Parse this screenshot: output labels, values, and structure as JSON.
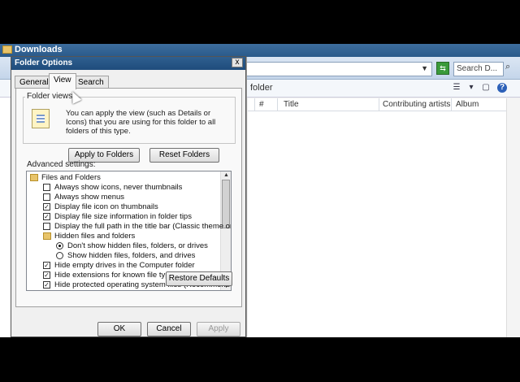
{
  "explorer": {
    "title": "Downloads",
    "search_placeholder": "Search D...",
    "breadcrumb": "folder",
    "columns": [
      "#",
      "Title",
      "Contributing artists",
      "Album"
    ],
    "go_icon": "refresh-icon",
    "help_icon": "help-icon"
  },
  "dialog": {
    "title": "Folder Options",
    "close_label": "x",
    "tabs": [
      "General",
      "View",
      "Search"
    ],
    "active_tab": "View",
    "folder_views": {
      "label": "Folder views",
      "description": "You can apply the view (such as Details or Icons) that you are using for this folder to all folders of this type.",
      "apply_button": "Apply to Folders",
      "reset_button": "Reset Folders"
    },
    "advanced_label": "Advanced settings:",
    "settings": [
      {
        "type": "folder",
        "label": "Files and Folders",
        "indent": 0
      },
      {
        "type": "checkbox",
        "label": "Always show icons, never thumbnails",
        "checked": false,
        "indent": 1
      },
      {
        "type": "checkbox",
        "label": "Always show menus",
        "checked": false,
        "indent": 1
      },
      {
        "type": "checkbox",
        "label": "Display file icon on thumbnails",
        "checked": true,
        "indent": 1
      },
      {
        "type": "checkbox",
        "label": "Display file size information in folder tips",
        "checked": true,
        "indent": 1
      },
      {
        "type": "checkbox",
        "label": "Display the full path in the title bar (Classic theme only)",
        "checked": false,
        "indent": 1
      },
      {
        "type": "folder",
        "label": "Hidden files and folders",
        "indent": 1
      },
      {
        "type": "radio",
        "label": "Don't show hidden files, folders, or drives",
        "checked": true,
        "indent": 2
      },
      {
        "type": "radio",
        "label": "Show hidden files, folders, and drives",
        "checked": false,
        "indent": 2
      },
      {
        "type": "checkbox",
        "label": "Hide empty drives in the Computer folder",
        "checked": true,
        "indent": 1
      },
      {
        "type": "checkbox",
        "label": "Hide extensions for known file types",
        "checked": true,
        "indent": 1
      },
      {
        "type": "checkbox",
        "label": "Hide protected operating system files (Recommended)",
        "checked": true,
        "indent": 1
      }
    ],
    "restore_button": "Restore Defaults",
    "ok_button": "OK",
    "cancel_button": "Cancel",
    "apply_button": "Apply"
  }
}
